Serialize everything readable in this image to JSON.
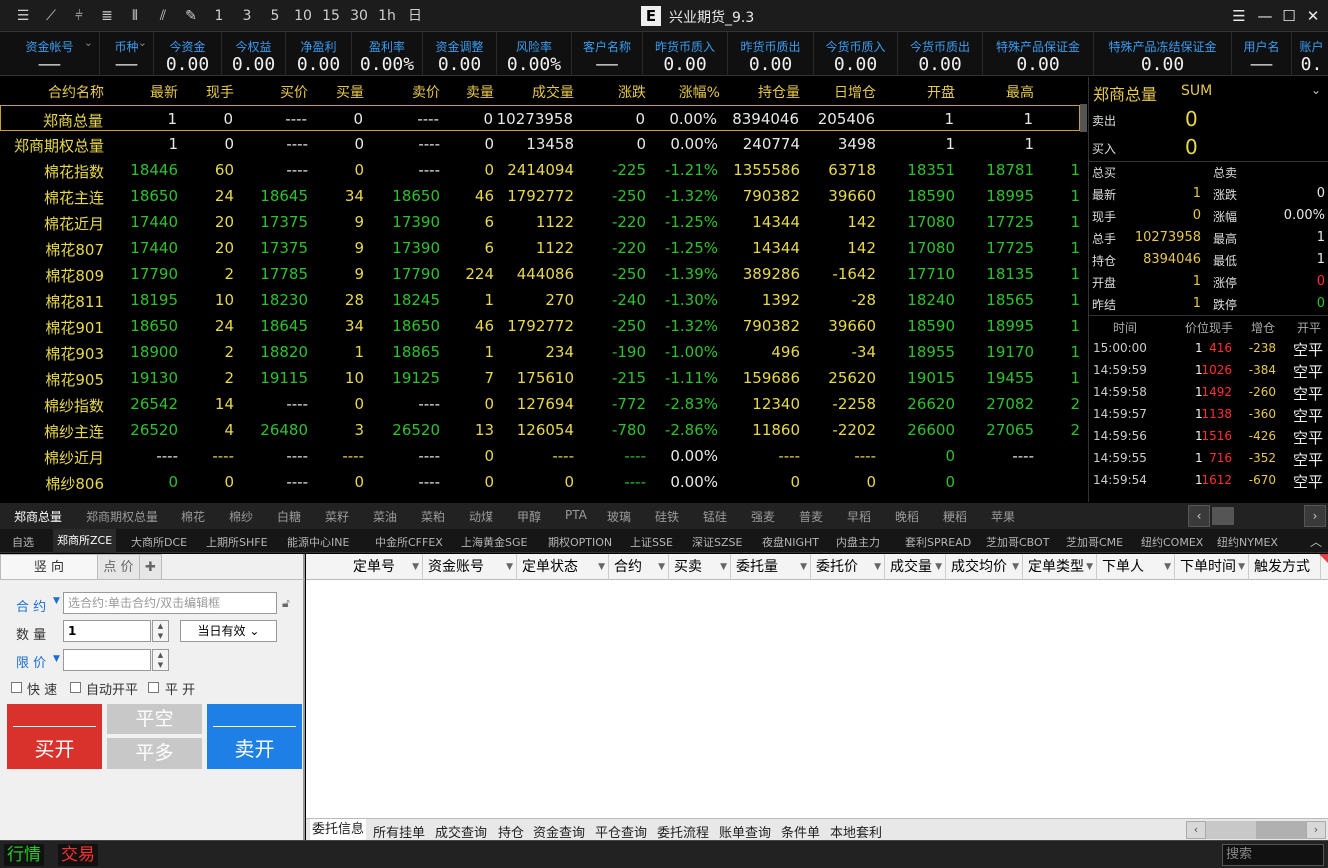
{
  "title": "兴业期货_9.3",
  "account_bar": [
    {
      "label": "资金帐号",
      "value": "——"
    },
    {
      "label": "币种",
      "value": "——"
    },
    {
      "label": "今资金",
      "value": "0.00"
    },
    {
      "label": "今权益",
      "value": "0.00"
    },
    {
      "label": "净盈利",
      "value": "0.00"
    },
    {
      "label": "盈利率",
      "value": "0.00%"
    },
    {
      "label": "资金调整",
      "value": "0.00"
    },
    {
      "label": "风险率",
      "value": "0.00%"
    },
    {
      "label": "客户名称",
      "value": "——"
    },
    {
      "label": "昨货币质入",
      "value": "0.00"
    },
    {
      "label": "昨货币质出",
      "value": "0.00"
    },
    {
      "label": "今货币质入",
      "value": "0.00"
    },
    {
      "label": "今货币质出",
      "value": "0.00"
    },
    {
      "label": "特殊产品保证金",
      "value": "0.00"
    },
    {
      "label": "特殊产品冻结保证金",
      "value": "0.00"
    },
    {
      "label": "用户名",
      "value": "——"
    },
    {
      "label": "账户",
      "value": "0."
    }
  ],
  "quote_headers": [
    "合约名称",
    "最新",
    "现手",
    "买价",
    "买量",
    "卖价",
    "卖量",
    "成交量",
    "涨跌",
    "涨幅%",
    "持仓量",
    "日增仓",
    "开盘",
    "最高"
  ],
  "quote_rows": [
    [
      "郑商总量",
      "1",
      "0",
      "----",
      "0",
      "----",
      "0",
      "10273958",
      "0",
      "0.00%",
      "8394046",
      "205406",
      "1",
      "1",
      ""
    ],
    [
      "郑商期权总量",
      "1",
      "0",
      "----",
      "0",
      "----",
      "0",
      "13458",
      "0",
      "0.00%",
      "240774",
      "3498",
      "1",
      "1",
      ""
    ],
    [
      "棉花指数",
      "18446",
      "60",
      "----",
      "0",
      "----",
      "0",
      "2414094",
      "-225",
      "-1.21%",
      "1355586",
      "63718",
      "18351",
      "18781",
      "1"
    ],
    [
      "棉花主连",
      "18650",
      "24",
      "18645",
      "34",
      "18650",
      "46",
      "1792772",
      "-250",
      "-1.32%",
      "790382",
      "39660",
      "18590",
      "18995",
      "1"
    ],
    [
      "棉花近月",
      "17440",
      "20",
      "17375",
      "9",
      "17390",
      "6",
      "1122",
      "-220",
      "-1.25%",
      "14344",
      "142",
      "17080",
      "17725",
      "1"
    ],
    [
      "棉花807",
      "17440",
      "20",
      "17375",
      "9",
      "17390",
      "6",
      "1122",
      "-220",
      "-1.25%",
      "14344",
      "142",
      "17080",
      "17725",
      "1"
    ],
    [
      "棉花809",
      "17790",
      "2",
      "17785",
      "9",
      "17790",
      "224",
      "444086",
      "-250",
      "-1.39%",
      "389286",
      "-1642",
      "17710",
      "18135",
      "1"
    ],
    [
      "棉花811",
      "18195",
      "10",
      "18230",
      "28",
      "18245",
      "1",
      "270",
      "-240",
      "-1.30%",
      "1392",
      "-28",
      "18240",
      "18565",
      "1"
    ],
    [
      "棉花901",
      "18650",
      "24",
      "18645",
      "34",
      "18650",
      "46",
      "1792772",
      "-250",
      "-1.32%",
      "790382",
      "39660",
      "18590",
      "18995",
      "1"
    ],
    [
      "棉花903",
      "18900",
      "2",
      "18820",
      "1",
      "18865",
      "1",
      "234",
      "-190",
      "-1.00%",
      "496",
      "-34",
      "18955",
      "19170",
      "1"
    ],
    [
      "棉花905",
      "19130",
      "2",
      "19115",
      "10",
      "19125",
      "7",
      "175610",
      "-215",
      "-1.11%",
      "159686",
      "25620",
      "19015",
      "19455",
      "1"
    ],
    [
      "棉纱指数",
      "26542",
      "14",
      "----",
      "0",
      "----",
      "0",
      "127694",
      "-772",
      "-2.83%",
      "12340",
      "-2258",
      "26620",
      "27082",
      "2"
    ],
    [
      "棉纱主连",
      "26520",
      "4",
      "26480",
      "3",
      "26520",
      "13",
      "126054",
      "-780",
      "-2.86%",
      "11860",
      "-2202",
      "26600",
      "27065",
      "2"
    ],
    [
      "棉纱近月",
      "----",
      "----",
      "----",
      "----",
      "----",
      "0",
      "----",
      "----",
      "0.00%",
      "----",
      "----",
      "0",
      "----",
      ""
    ],
    [
      "棉纱806",
      "0",
      "0",
      "----",
      "0",
      "----",
      "0",
      "0",
      "----",
      "0.00%",
      "0",
      "0",
      "0",
      "",
      ""
    ]
  ],
  "right_panel": {
    "title": "郑商总量",
    "code": "SUM",
    "sell_label": "卖出",
    "sell_value": "0",
    "buy_label": "买入",
    "buy_value": "0",
    "stats": [
      [
        "总买",
        "",
        "总卖",
        ""
      ],
      [
        "最新",
        "1",
        "涨跌",
        "0"
      ],
      [
        "现手",
        "0",
        "涨幅",
        "0.00%"
      ],
      [
        "总手",
        "10273958",
        "最高",
        "1"
      ],
      [
        "持仓",
        "8394046",
        "最低",
        "1"
      ],
      [
        "开盘",
        "1",
        "涨停",
        "0"
      ],
      [
        "昨结",
        "1",
        "跌停",
        "0"
      ]
    ],
    "tick_headers": [
      "时间",
      "价位",
      "现手",
      "增仓",
      "开平"
    ],
    "ticks": [
      [
        "15:00:00",
        "1",
        "416",
        "-238",
        "空平"
      ],
      [
        "14:59:59",
        "1",
        "1026",
        "-384",
        "空平"
      ],
      [
        "14:59:58",
        "1",
        "1492",
        "-260",
        "空平"
      ],
      [
        "14:59:57",
        "1",
        "1138",
        "-360",
        "空平"
      ],
      [
        "14:59:56",
        "1",
        "1516",
        "-426",
        "空平"
      ],
      [
        "14:59:55",
        "1",
        "716",
        "-352",
        "空平"
      ],
      [
        "14:59:54",
        "1",
        "1612",
        "-670",
        "空平"
      ]
    ]
  },
  "product_tabs": [
    "郑商总量",
    "郑商期权总量",
    "棉花",
    "棉纱",
    "白糖",
    "菜籽",
    "菜油",
    "菜粕",
    "动煤",
    "甲醇",
    "PTA",
    "玻璃",
    "硅铁",
    "锰硅",
    "强麦",
    "普麦",
    "早稻",
    "晚稻",
    "粳稻",
    "苹果"
  ],
  "exchange_tabs": [
    "自选",
    "郑商所ZCE",
    "大商所DCE",
    "上期所SHFE",
    "能源中心INE",
    "中金所CFFEX",
    "上海黄金SGE",
    "期权OPTION",
    "上证SSE",
    "深证SZSE",
    "夜盘NIGHT",
    "内盘主力",
    "套利SPREAD",
    "芝加哥CBOT",
    "芝加哥CME",
    "纽约COMEX",
    "纽约NYMEX"
  ],
  "order": {
    "tab_vertical": "竖 向",
    "tab_point": "点 价",
    "contract_label": "合 约",
    "contract_placeholder": "选合约:单击合约/双击编辑框",
    "qty_label": "数 量",
    "qty_value": "1",
    "validity": "当日有效",
    "price_label": "限 价",
    "fast": "快 速",
    "auto_open_close": "自动开平",
    "flat_open": "平 开",
    "buy_open": "买开",
    "close_short": "平空",
    "close_long": "平多",
    "sell_open": "卖开"
  },
  "grid_headers": [
    "定单号",
    "资金账号",
    "定单状态",
    "合约",
    "买卖",
    "委托量",
    "委托价",
    "成交量",
    "成交均价",
    "定单类型",
    "下单人",
    "下单时间",
    "触发方式"
  ],
  "bottom_tabs": [
    "委托信息",
    "所有挂单",
    "成交查询",
    "持仓",
    "资金查询",
    "平仓查询",
    "委托流程",
    "账单查询",
    "条件单",
    "本地套利"
  ],
  "status": {
    "quote": "行情",
    "trade": "交易",
    "search_placeholder": "搜索"
  },
  "colors": {
    "up": "#ff3030",
    "down": "#2ec12e",
    "label": "#e6c84a",
    "accent": "#3a9cf0"
  }
}
